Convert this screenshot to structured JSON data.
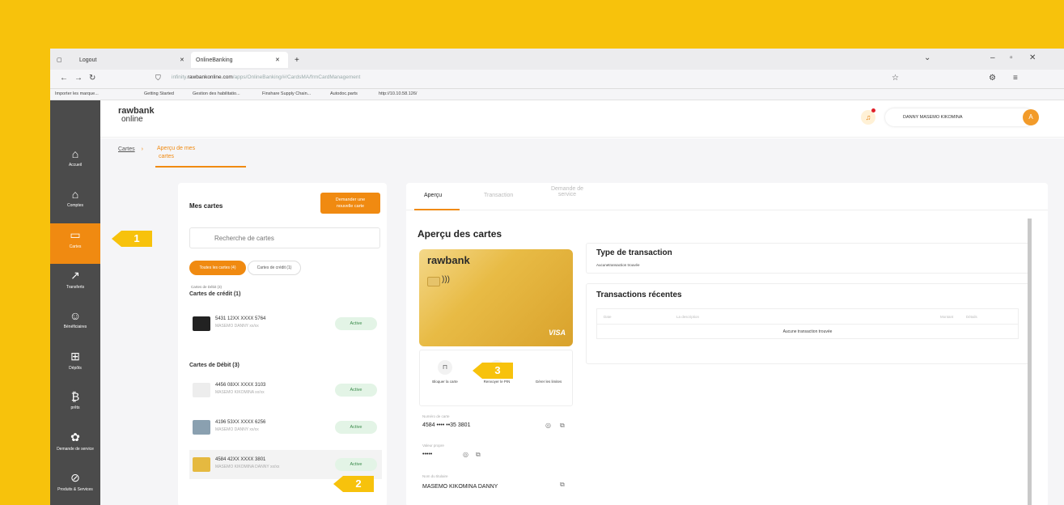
{
  "browser": {
    "tab1": "Logout",
    "tab2": "OnlineBanking",
    "url_prefix": "infinity.",
    "url_domain": "rawbankonline.com",
    "url_path": "/apps/OnlineBanking/#/CardsMA/frmCardManagement",
    "bookmarks": [
      "Importer les marque...",
      "Getting Started",
      "Gestion des habilitatio...",
      "Finshare Supply Chain...",
      "Autodoc.parts",
      "http://10.10.58.126/"
    ]
  },
  "app": {
    "logo_main": "rawbank",
    "logo_sub": "online",
    "user_name": "DANNY MASEMO KIKOMINA",
    "avatar_initial": "A"
  },
  "sidebar": {
    "items": [
      {
        "label": "Accueil",
        "icon": "home-icon",
        "glyph": "⌂"
      },
      {
        "label": "Comptes",
        "icon": "bank-icon",
        "glyph": "⌂"
      },
      {
        "label": "Cartes",
        "icon": "card-icon",
        "glyph": "▭"
      },
      {
        "label": "Transferts",
        "icon": "arrow-icon",
        "glyph": "↗"
      },
      {
        "label": "Bénéficiaires",
        "icon": "people-icon",
        "glyph": "☺"
      },
      {
        "label": "Dépôts",
        "icon": "deposit-icon",
        "glyph": "⊞"
      },
      {
        "label": "prêts",
        "icon": "loan-icon",
        "glyph": "₿"
      },
      {
        "label": "Demande de service",
        "icon": "service-icon",
        "glyph": "✿"
      },
      {
        "label": "Produits & Services",
        "icon": "products-icon",
        "glyph": "⊘"
      }
    ]
  },
  "breadcrumb": {
    "root": "Cartes",
    "current_line1": "Aperçu de mes",
    "current_line2": "cartes"
  },
  "left_panel": {
    "title": "Mes cartes",
    "new_card_button_line1": "Demander une",
    "new_card_button_line2": "nouvelle carte",
    "search_placeholder": "Recherche de cartes",
    "chip_all": "Toutes les cartes (4)",
    "chip_credit": "Cartes de crédit (1)",
    "debit_count_note": "Cartes de Débit (3)",
    "credit_section": "Cartes de crédit (1)",
    "debit_section": "Cartes de Débit (3)",
    "credit_cards": [
      {
        "number": "5431 12XX XXXX 5764",
        "holder": "MASEMO DANNY  xx/xx",
        "status": "Active"
      }
    ],
    "debit_cards": [
      {
        "number": "4456 08XX XXXX 3103",
        "holder": "MASEMO KIKOMINA  xx/xx",
        "status": "Active"
      },
      {
        "number": "4196 53XX XXXX 6256",
        "holder": "MASEMO DANNY  xx/xx",
        "status": "Active"
      },
      {
        "number": "4584 42XX XXXX 3801",
        "holder": "MASEMO KIKOMINA DANNY  xx/xx",
        "status": "Active"
      }
    ]
  },
  "right_panel": {
    "tabs": [
      "Aperçu",
      "Transaction",
      "Demande de service"
    ],
    "title": "Aperçu des cartes",
    "card_brand": "rawbank",
    "card_network": "VISA",
    "actions": [
      "Bloquer la carte",
      "Renvoyer le PIN",
      "Gérer les limites"
    ],
    "card_number_label": "Numéro de carte",
    "card_number_value": "4584 •••• ••35 3801",
    "cvv_label": "Valeur propre",
    "cvv_value": "•••••",
    "holder_label": "Nom du titulaire",
    "holder_value": "MASEMO KIKOMINA DANNY",
    "type_title": "Type de transaction",
    "type_empty": "Aucunetransaction trouvée",
    "recent_title": "Transactions récentes",
    "table_headers": [
      "Date",
      "La description",
      "Montant",
      "Détails"
    ],
    "table_empty": "Aucune transaction trouvée"
  },
  "callouts": [
    "1",
    "2",
    "3"
  ]
}
